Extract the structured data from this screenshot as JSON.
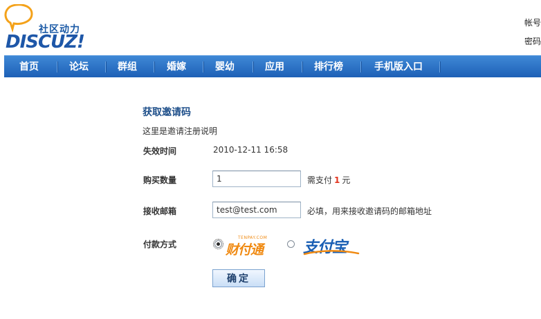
{
  "brand": {
    "cn": "社区动力",
    "en": "DISCUZ!"
  },
  "account": {
    "label": "帐号",
    "password_label": "密码"
  },
  "nav": [
    {
      "label": "首页"
    },
    {
      "label": "论坛"
    },
    {
      "label": "群组"
    },
    {
      "label": "婚嫁"
    },
    {
      "label": "婴幼"
    },
    {
      "label": "应用"
    },
    {
      "label": "排行榜"
    },
    {
      "label": "手机版入口"
    }
  ],
  "form": {
    "title": "获取邀请码",
    "description": "这里是邀请注册说明",
    "expire": {
      "label": "失效时间",
      "value": "2010-12-11 16:58"
    },
    "quantity": {
      "label": "购买数量",
      "value": "1",
      "hint_prefix": "需支付",
      "price": "1",
      "hint_suffix": "元"
    },
    "email": {
      "label": "接收邮箱",
      "value": "test@test.com",
      "hint": "必填，用来接收邀请码的邮箱地址"
    },
    "payment": {
      "label": "付款方式",
      "options": [
        {
          "name": "财付通",
          "tagline": "TENPAY.COM",
          "checked": true
        },
        {
          "name": "支付宝",
          "tagline": "",
          "checked": false
        }
      ]
    },
    "submit_label": "确定"
  },
  "colors": {
    "nav_top": "#3f88d6",
    "nav_bottom": "#1d60b6",
    "brand_blue": "#1e57a8",
    "price_red": "#e2351f",
    "tenpay_orange": "#f08a12",
    "alipay_blue": "#1a5fb4"
  }
}
